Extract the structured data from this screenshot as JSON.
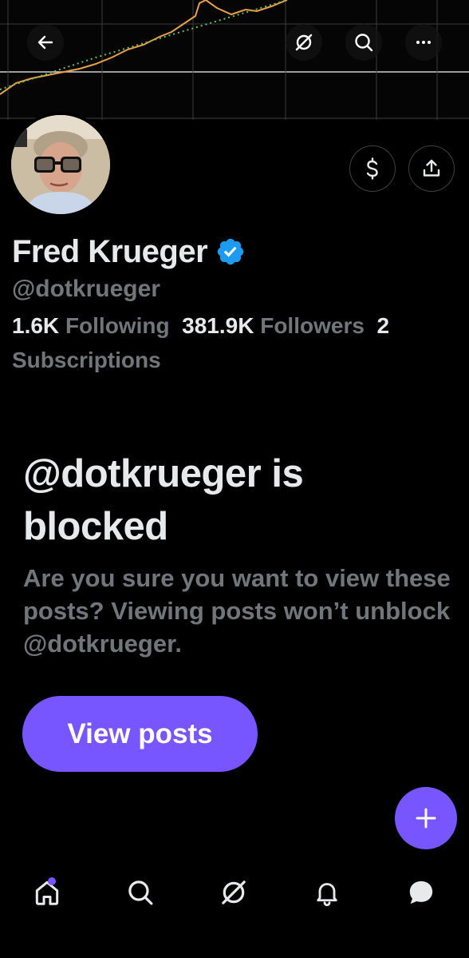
{
  "colors": {
    "accent": "#7856ff",
    "verified": "#1d9bf0",
    "muted_text": "#71767b",
    "primary_text": "#e7e9ea",
    "background": "#000000"
  },
  "header": {
    "icons": [
      "back-arrow-icon",
      "grok-icon",
      "search-icon",
      "more-icon"
    ]
  },
  "profile": {
    "name": "Fred Krueger",
    "handle": "@dotkrueger",
    "verified_icon": "verified-badge-icon",
    "actions": [
      "subscribe-dollar-icon",
      "share-icon"
    ],
    "stats": {
      "following_count": "1.6K",
      "following_label": "Following",
      "followers_count": "381.9K",
      "followers_label": "Followers",
      "subscriptions_count": "2",
      "subscriptions_label": "Subscriptions"
    }
  },
  "blocked": {
    "title": "@dotkrueger is blocked",
    "description": "Are you sure you want to view these posts? Viewing posts won’t unblock @dotkrueger.",
    "button_label": "View posts"
  },
  "fab": {
    "icon": "plus-icon"
  },
  "bottom_nav": {
    "items": [
      "home-icon",
      "search-icon",
      "grok-icon",
      "notifications-icon",
      "messages-icon"
    ]
  }
}
